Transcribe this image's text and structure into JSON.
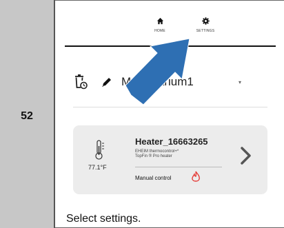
{
  "step": {
    "number": "52"
  },
  "nav": {
    "home_label": "HOME",
    "settings_label": "SETTINGS"
  },
  "aquarium": {
    "name": "MyAquarium1",
    "dropdown_symbol": "▾"
  },
  "heater": {
    "title": "Heater_16663265",
    "description": "EHEIM thermocontrol+*\nTopFin ® Pro heater",
    "temperature": "77.1°F",
    "control_mode": "Manual control",
    "open_symbol": ">"
  },
  "instruction": {
    "text": "Select settings."
  },
  "colors": {
    "accent_arrow": "#2e6fb3",
    "flame": "#e53935",
    "step_cell": "#c7c7c7",
    "card": "#ececec"
  }
}
